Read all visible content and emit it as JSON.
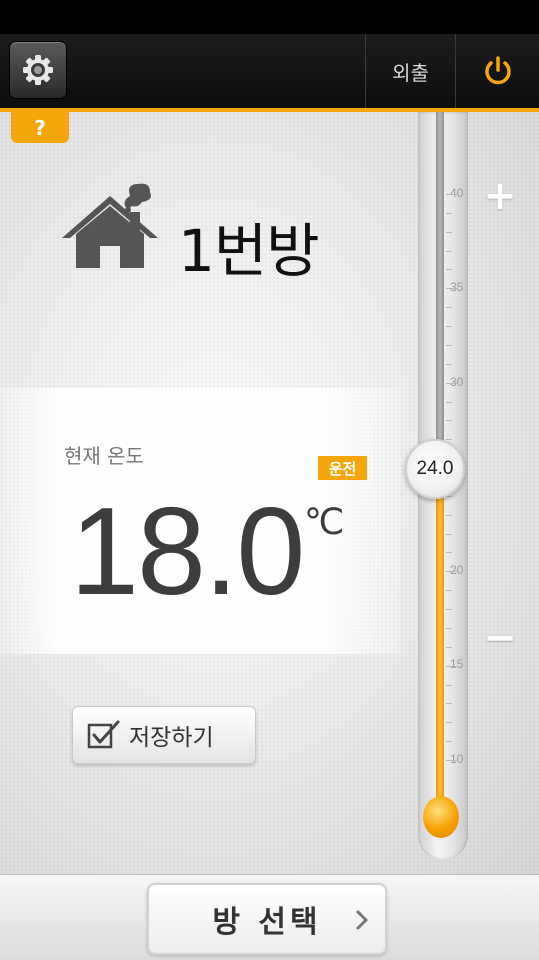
{
  "header": {
    "away_label": "외출"
  },
  "help": {
    "label": "?"
  },
  "room": {
    "name": "1번방"
  },
  "current": {
    "label": "현재 온도",
    "value": "18.0",
    "unit": "℃",
    "status": "운전"
  },
  "save": {
    "label": "저장하기"
  },
  "thermometer": {
    "setpoint": "24.0",
    "ticks": [
      "40",
      "35",
      "30",
      "20",
      "15",
      "10"
    ],
    "plus": "+",
    "minus": "−"
  },
  "footer": {
    "room_select_label": "방 선택"
  },
  "colors": {
    "accent": "#f5a60a",
    "dark": "#111111",
    "text": "#3d3d3d"
  }
}
